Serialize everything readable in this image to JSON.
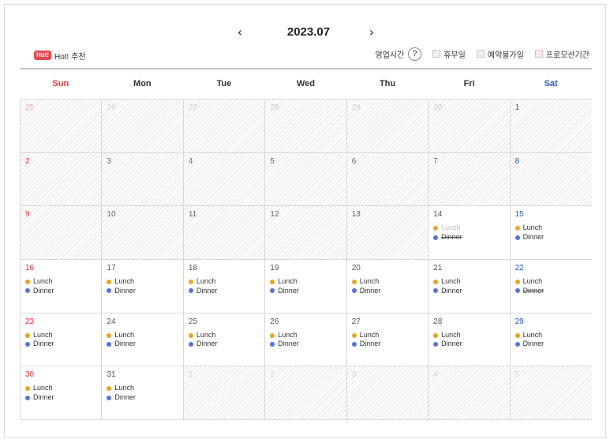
{
  "header": {
    "month": "2023.07",
    "prev_icon": "chevron-left-icon",
    "next_icon": "chevron-right-icon",
    "prev_glyph": "‹",
    "next_glyph": "›"
  },
  "legend": {
    "hot_badge": "Hot!",
    "hot_label": "Hot! 추천",
    "hours_label": "영업시간",
    "help": "?",
    "holiday": "휴무일",
    "unavailable": "예약불가일",
    "promo": "프로모션기간"
  },
  "colors": {
    "sunday": "#e5393a",
    "saturday": "#2a5cb4",
    "lunch_dot": "#e5a624",
    "dinner_dot": "#5774d4",
    "hot_badge": "#e5484d"
  },
  "weekdays": [
    "Sun",
    "Mon",
    "Tue",
    "Wed",
    "Thu",
    "Fri",
    "Sat"
  ],
  "weeks": [
    [
      {
        "date": "25",
        "other": true,
        "closed": true,
        "meals": []
      },
      {
        "date": "26",
        "other": true,
        "closed": true,
        "meals": []
      },
      {
        "date": "27",
        "other": true,
        "closed": true,
        "meals": []
      },
      {
        "date": "28",
        "other": true,
        "closed": true,
        "meals": []
      },
      {
        "date": "29",
        "other": true,
        "closed": true,
        "meals": []
      },
      {
        "date": "30",
        "other": true,
        "closed": true,
        "meals": []
      },
      {
        "date": "1",
        "other": false,
        "closed": true,
        "meals": []
      }
    ],
    [
      {
        "date": "2",
        "other": false,
        "closed": true,
        "meals": []
      },
      {
        "date": "3",
        "other": false,
        "closed": true,
        "meals": []
      },
      {
        "date": "4",
        "other": false,
        "closed": true,
        "meals": []
      },
      {
        "date": "5",
        "other": false,
        "closed": true,
        "meals": []
      },
      {
        "date": "6",
        "other": false,
        "closed": true,
        "meals": []
      },
      {
        "date": "7",
        "other": false,
        "closed": true,
        "meals": []
      },
      {
        "date": "8",
        "other": false,
        "closed": true,
        "meals": []
      }
    ],
    [
      {
        "date": "9",
        "other": false,
        "closed": true,
        "meals": []
      },
      {
        "date": "10",
        "other": false,
        "closed": true,
        "meals": []
      },
      {
        "date": "11",
        "other": false,
        "closed": true,
        "meals": []
      },
      {
        "date": "12",
        "other": false,
        "closed": true,
        "meals": []
      },
      {
        "date": "13",
        "other": false,
        "closed": true,
        "meals": []
      },
      {
        "date": "14",
        "other": false,
        "closed": false,
        "meals": [
          {
            "type": "lunch",
            "label": "Lunch",
            "state": "faded"
          },
          {
            "type": "dinner",
            "label": "Dinner",
            "state": "strike"
          }
        ]
      },
      {
        "date": "15",
        "other": false,
        "closed": false,
        "meals": [
          {
            "type": "lunch",
            "label": "Lunch",
            "state": "normal"
          },
          {
            "type": "dinner",
            "label": "Dinner",
            "state": "normal"
          }
        ]
      }
    ],
    [
      {
        "date": "16",
        "other": false,
        "closed": false,
        "meals": [
          {
            "type": "lunch",
            "label": "Lunch",
            "state": "normal"
          },
          {
            "type": "dinner",
            "label": "Dinner",
            "state": "normal"
          }
        ]
      },
      {
        "date": "17",
        "other": false,
        "closed": false,
        "meals": [
          {
            "type": "lunch",
            "label": "Lunch",
            "state": "normal"
          },
          {
            "type": "dinner",
            "label": "Dinner",
            "state": "normal"
          }
        ]
      },
      {
        "date": "18",
        "other": false,
        "closed": false,
        "meals": [
          {
            "type": "lunch",
            "label": "Lunch",
            "state": "normal"
          },
          {
            "type": "dinner",
            "label": "Dinner",
            "state": "normal"
          }
        ]
      },
      {
        "date": "19",
        "other": false,
        "closed": false,
        "meals": [
          {
            "type": "lunch",
            "label": "Lunch",
            "state": "normal"
          },
          {
            "type": "dinner",
            "label": "Dinner",
            "state": "normal"
          }
        ]
      },
      {
        "date": "20",
        "other": false,
        "closed": false,
        "meals": [
          {
            "type": "lunch",
            "label": "Lunch",
            "state": "normal"
          },
          {
            "type": "dinner",
            "label": "Dinner",
            "state": "normal"
          }
        ]
      },
      {
        "date": "21",
        "other": false,
        "closed": false,
        "meals": [
          {
            "type": "lunch",
            "label": "Lunch",
            "state": "normal"
          },
          {
            "type": "dinner",
            "label": "Dinner",
            "state": "normal"
          }
        ]
      },
      {
        "date": "22",
        "other": false,
        "closed": false,
        "meals": [
          {
            "type": "lunch",
            "label": "Lunch",
            "state": "normal"
          },
          {
            "type": "dinner",
            "label": "Dinner",
            "state": "strike"
          }
        ]
      }
    ],
    [
      {
        "date": "23",
        "other": false,
        "closed": false,
        "meals": [
          {
            "type": "lunch",
            "label": "Lunch",
            "state": "normal"
          },
          {
            "type": "dinner",
            "label": "Dinner",
            "state": "normal"
          }
        ]
      },
      {
        "date": "24",
        "other": false,
        "closed": false,
        "meals": [
          {
            "type": "lunch",
            "label": "Lunch",
            "state": "normal"
          },
          {
            "type": "dinner",
            "label": "Dinner",
            "state": "normal"
          }
        ]
      },
      {
        "date": "25",
        "other": false,
        "closed": false,
        "meals": [
          {
            "type": "lunch",
            "label": "Lunch",
            "state": "normal"
          },
          {
            "type": "dinner",
            "label": "Dinner",
            "state": "normal"
          }
        ]
      },
      {
        "date": "26",
        "other": false,
        "closed": false,
        "meals": [
          {
            "type": "lunch",
            "label": "Lunch",
            "state": "normal"
          },
          {
            "type": "dinner",
            "label": "Dinner",
            "state": "normal"
          }
        ]
      },
      {
        "date": "27",
        "other": false,
        "closed": false,
        "meals": [
          {
            "type": "lunch",
            "label": "Lunch",
            "state": "normal"
          },
          {
            "type": "dinner",
            "label": "Dinner",
            "state": "normal"
          }
        ]
      },
      {
        "date": "28",
        "other": false,
        "closed": false,
        "meals": [
          {
            "type": "lunch",
            "label": "Lunch",
            "state": "normal"
          },
          {
            "type": "dinner",
            "label": "Dinner",
            "state": "normal"
          }
        ]
      },
      {
        "date": "29",
        "other": false,
        "closed": false,
        "meals": [
          {
            "type": "lunch",
            "label": "Lunch",
            "state": "normal"
          },
          {
            "type": "dinner",
            "label": "Dinner",
            "state": "normal"
          }
        ]
      }
    ],
    [
      {
        "date": "30",
        "other": false,
        "closed": false,
        "meals": [
          {
            "type": "lunch",
            "label": "Lunch",
            "state": "normal"
          },
          {
            "type": "dinner",
            "label": "Dinner",
            "state": "normal"
          }
        ]
      },
      {
        "date": "31",
        "other": false,
        "closed": false,
        "meals": [
          {
            "type": "lunch",
            "label": "Lunch",
            "state": "normal"
          },
          {
            "type": "dinner",
            "label": "Dinner",
            "state": "normal"
          }
        ]
      },
      {
        "date": "1",
        "other": true,
        "closed": true,
        "meals": []
      },
      {
        "date": "2",
        "other": true,
        "closed": true,
        "meals": []
      },
      {
        "date": "3",
        "other": true,
        "closed": true,
        "meals": []
      },
      {
        "date": "4",
        "other": true,
        "closed": true,
        "meals": []
      },
      {
        "date": "5",
        "other": true,
        "closed": true,
        "meals": []
      }
    ]
  ]
}
